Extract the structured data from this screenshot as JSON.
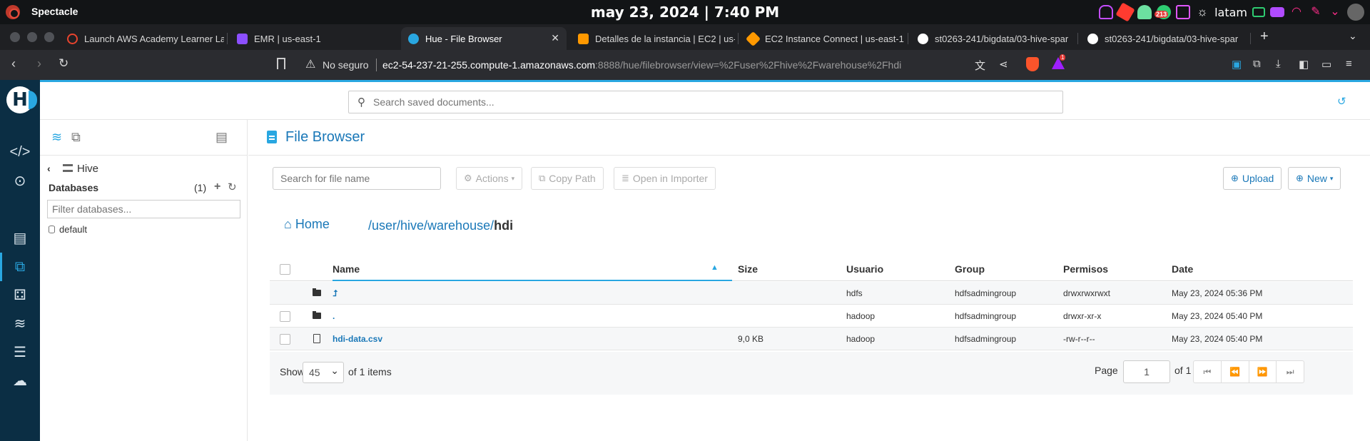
{
  "os": {
    "app_name": "Spectacle",
    "clock": "may 23, 2024 | 7:40 PM",
    "user": "latam",
    "badge_count": "213"
  },
  "tabs": [
    {
      "title": "Launch AWS Academy Learner La",
      "color": "#e8442e"
    },
    {
      "title": "EMR | us-east-1",
      "color": "#8c4fff"
    },
    {
      "title": "Hue - File Browser",
      "color": "#29a7e1",
      "active": true
    },
    {
      "title": "Detalles de la instancia | EC2 | us-",
      "color": "#ff9900"
    },
    {
      "title": "EC2 Instance Connect | us-east-1",
      "color": "#ff9900"
    },
    {
      "title": "st0263-241/bigdata/03-hive-spar",
      "color": "#ffffff"
    },
    {
      "title": "st0263-241/bigdata/03-hive-spar",
      "color": "#ffffff"
    }
  ],
  "addressbar": {
    "security": "No seguro",
    "url_host": "ec2-54-237-21-255.compute-1.amazonaws.com",
    "url_rest": ":8888/hue/filebrowser/view=%2Fuser%2Fhive%2Fwarehouse%2Fhdi",
    "notif_count": "1"
  },
  "hue": {
    "search_placeholder": "Search saved documents..."
  },
  "assist": {
    "back_label": "Hive",
    "databases_title": "Databases",
    "databases_count": "(1)",
    "filter_placeholder": "Filter databases...",
    "databases": [
      "default"
    ]
  },
  "filebrowser": {
    "title": "File Browser",
    "search_placeholder": "Search for file name",
    "actions_label": "Actions",
    "copy_path_label": "Copy Path",
    "open_importer_label": "Open in Importer",
    "upload_label": "Upload",
    "new_label": "New",
    "home_label": "Home",
    "path_prefix": "/user/hive/warehouse/",
    "path_last": "hdi",
    "columns": [
      "Name",
      "Size",
      "Usuario",
      "Group",
      "Permisos",
      "Date"
    ],
    "rows": [
      {
        "type": "folder",
        "name": "⮥",
        "size": "",
        "user": "hdfs",
        "group": "hdfsadmingroup",
        "perms": "drwxrwxrwxt",
        "date": "May 23, 2024 05:36 PM",
        "checkbox": false
      },
      {
        "type": "folder",
        "name": ".",
        "size": "",
        "user": "hadoop",
        "group": "hdfsadmingroup",
        "perms": "drwxr-xr-x",
        "date": "May 23, 2024 05:40 PM",
        "checkbox": true
      },
      {
        "type": "file",
        "name": "hdi-data.csv",
        "size": "9,0 KB",
        "user": "hadoop",
        "group": "hdfsadmingroup",
        "perms": "-rw-r--r--",
        "date": "May 23, 2024 05:40 PM",
        "checkbox": true
      }
    ],
    "show_label": "Show",
    "page_size": "45",
    "items_label": "of 1 items",
    "page_label": "Page",
    "page_value": "1",
    "of_label": "of 1"
  }
}
